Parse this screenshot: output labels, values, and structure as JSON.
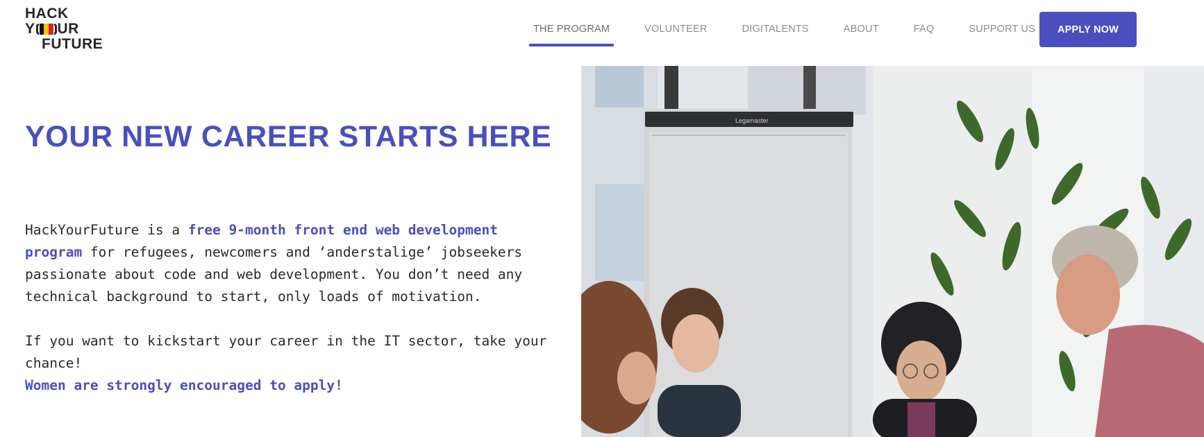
{
  "logo": {
    "line1": "HACK",
    "line2_a": "Y",
    "line2_b": "UR",
    "line3": "FUTURE",
    "flag_colors": [
      "#111111",
      "#f5c400",
      "#d6222b"
    ]
  },
  "nav": {
    "items": [
      {
        "label": "THE PROGRAM",
        "active": true
      },
      {
        "label": "VOLUNTEER"
      },
      {
        "label": "DIGITALENTS"
      },
      {
        "label": "ABOUT"
      },
      {
        "label": "FAQ"
      },
      {
        "label": "SUPPORT US"
      }
    ],
    "apply_label": "APPLY NOW"
  },
  "hero": {
    "title": "YOUR NEW CAREER STARTS HERE",
    "p1_prefix": "HackYourFuture is a ",
    "p1_highlight": "free 9-month front end web development program",
    "p1_suffix": " for refugees, newcomers and ‘anderstalige’ jobseekers passionate about code and web development. You don’t need any technical background to start, only loads of motivation.",
    "p2": "If you want to kickstart your career in the IT sector, take your chance!",
    "p3": "Women are strongly encouraged to apply!"
  },
  "photo": {
    "flipchart_brand": "Legamaster"
  },
  "colors": {
    "accent": "#4a4fbf",
    "text": "#2a2a2a",
    "nav_text": "#8c8c8c"
  }
}
